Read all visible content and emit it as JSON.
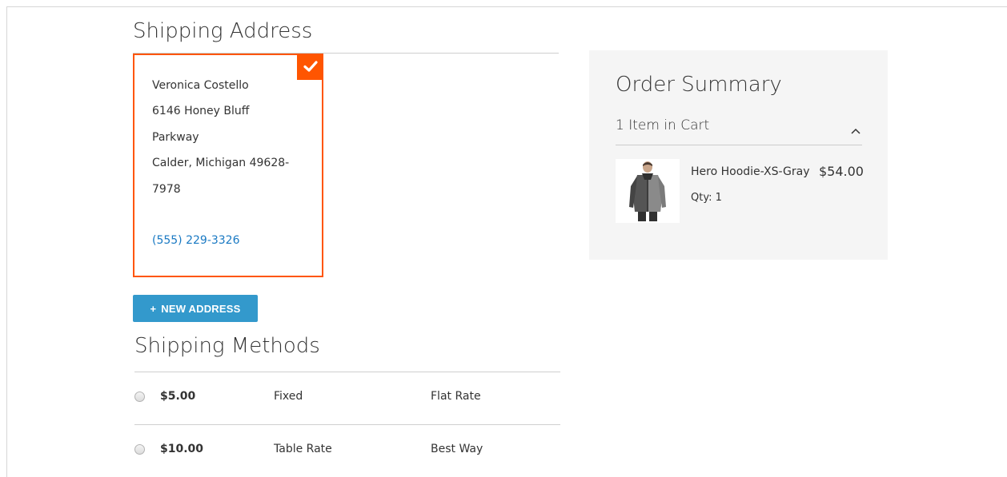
{
  "shipping_address": {
    "title": "Shipping Address",
    "lines": [
      "Veronica Costello",
      "6146 Honey Bluff",
      "Parkway",
      "Calder, Michigan 49628-",
      "7978"
    ],
    "phone": "(555) 229-3326",
    "selected_icon": "check-icon",
    "new_address_label": "NEW ADDRESS",
    "accent_color": "#ff5501",
    "button_color": "#3399cc"
  },
  "shipping_methods": {
    "title": "Shipping Methods",
    "rows": [
      {
        "price": "$5.00",
        "method": "Fixed",
        "carrier": "Flat Rate"
      },
      {
        "price": "$10.00",
        "method": "Table Rate",
        "carrier": "Best Way"
      }
    ]
  },
  "order_summary": {
    "title": "Order Summary",
    "cart_count": "1 Item in Cart",
    "toggle_icon": "chevron-up-icon",
    "item": {
      "name": "Hero Hoodie-XS-Gray",
      "price": "$54.00",
      "qty": "Qty: 1"
    }
  }
}
